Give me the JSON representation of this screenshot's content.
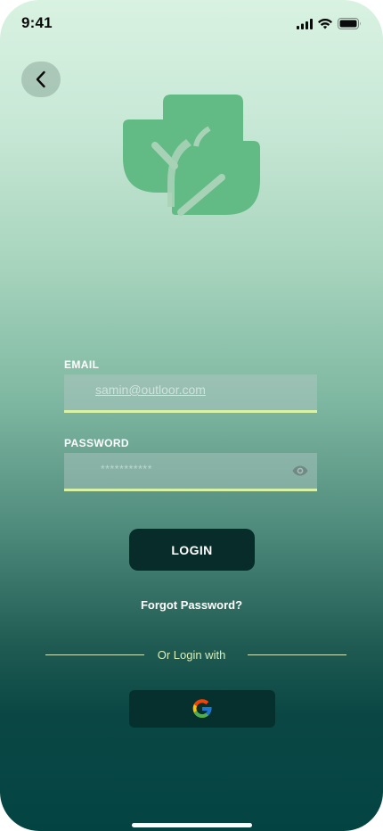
{
  "status_bar": {
    "time": "9:41",
    "icons": [
      "cellular-signal-icon",
      "wifi-icon",
      "battery-icon"
    ]
  },
  "nav": {
    "back_icon": "chevron-left-icon"
  },
  "logo": {
    "icon": "leaves-icon",
    "color": "#62bb84"
  },
  "form": {
    "email": {
      "label": "EMAIL",
      "value": "samin@outloor.com"
    },
    "password": {
      "label": "PASSWORD",
      "value": "***********",
      "toggle_icon": "eye-icon"
    }
  },
  "actions": {
    "login_label": "LOGIN",
    "forgot_label": "Forgot Password?",
    "divider_text": "Or Login with",
    "google_icon": "google-icon"
  },
  "colors": {
    "accent_underline": "#d8f3a6",
    "button_dark": "#072c2a",
    "background_top": "#d9f2e2",
    "background_bottom": "#034443"
  }
}
